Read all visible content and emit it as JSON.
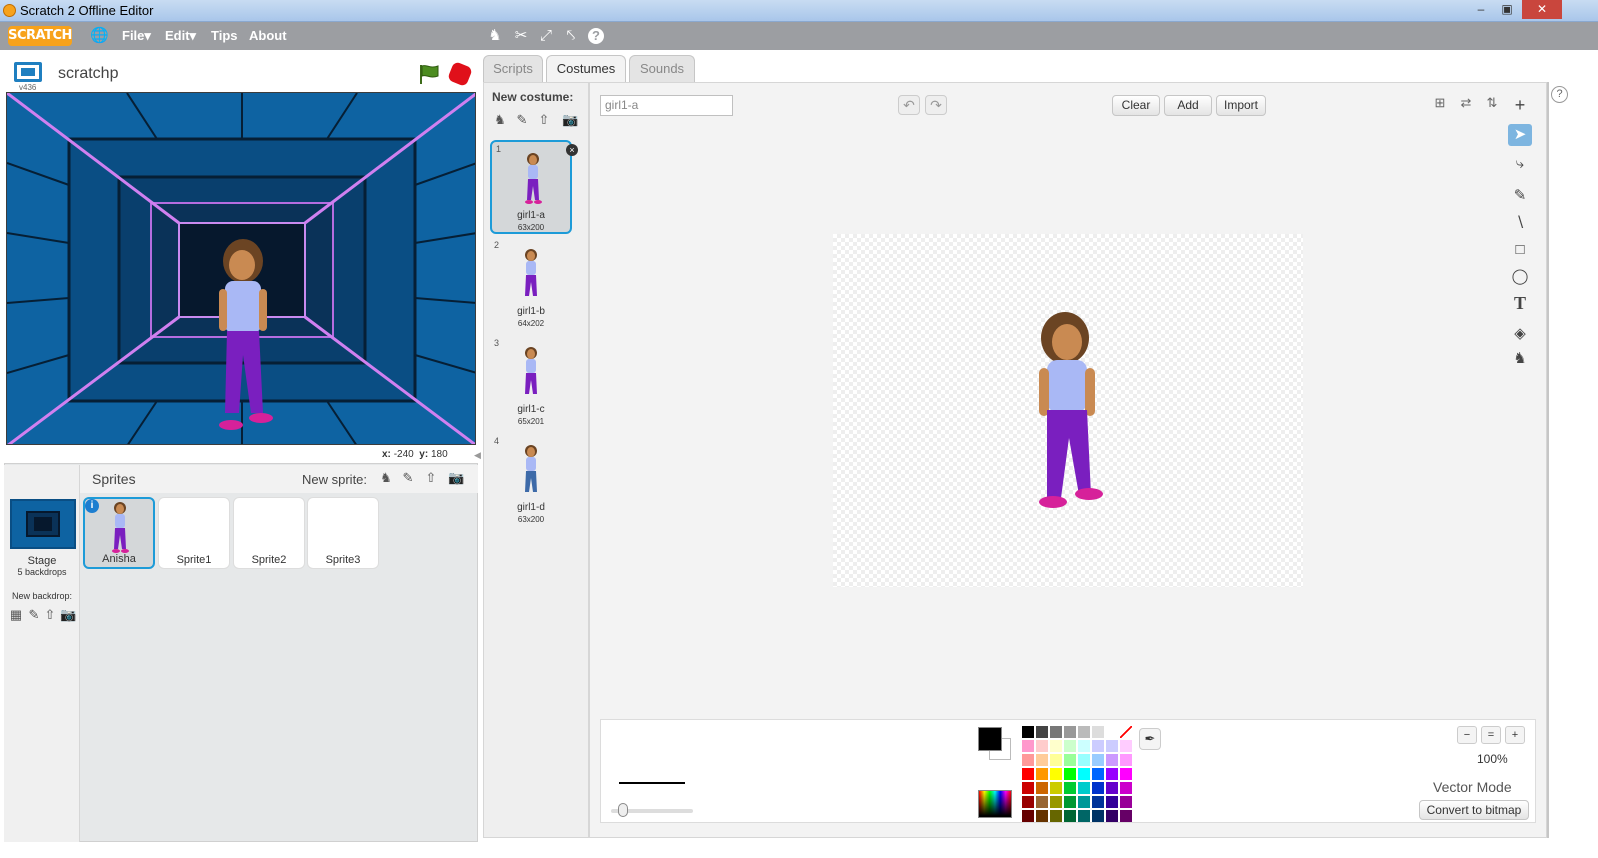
{
  "window": {
    "title": "Scratch 2 Offline Editor",
    "minimize": "–",
    "maximize": "▣",
    "close": "✕"
  },
  "menubar": {
    "logo": "SCRATCH",
    "file": "File▾",
    "edit": "Edit▾",
    "tips": "Tips",
    "about": "About",
    "icons": [
      "language-globe-icon",
      "duplicate-stamp-icon",
      "delete-cut-icon",
      "grow-icon",
      "shrink-icon",
      "help-icon"
    ]
  },
  "stage": {
    "project_name": "scratchp",
    "version": "v436",
    "coords_label_x": "x:",
    "coords_x": "-240",
    "coords_label_y": "y:",
    "coords_y": "180"
  },
  "sprites": {
    "header": "Sprites",
    "new_sprite_label": "New sprite:",
    "stage_label": "Stage",
    "stage_backdrops": "5 backdrops",
    "new_backdrop_label": "New backdrop:",
    "items": [
      {
        "name": "Anisha"
      },
      {
        "name": "Sprite1"
      },
      {
        "name": "Sprite2"
      },
      {
        "name": "Sprite3"
      }
    ]
  },
  "tabs": [
    "Scripts",
    "Costumes",
    "Sounds"
  ],
  "costumes": {
    "new_costume_label": "New costume:",
    "items": [
      {
        "num": "1",
        "name": "girl1-a",
        "size": "63x200"
      },
      {
        "num": "2",
        "name": "girl1-b",
        "size": "64x202"
      },
      {
        "num": "3",
        "name": "girl1-c",
        "size": "65x201"
      },
      {
        "num": "4",
        "name": "girl1-d",
        "size": "63x200"
      }
    ]
  },
  "editor": {
    "costume_name": "girl1-a",
    "clear": "Clear",
    "add": "Add",
    "import": "Import",
    "zoom": "100%",
    "mode": "Vector Mode",
    "convert": "Convert to bitmap"
  },
  "colors": {
    "accent": "#1d9bd8",
    "menubar": "#9c9ea2",
    "brand": "#f7a21b"
  }
}
